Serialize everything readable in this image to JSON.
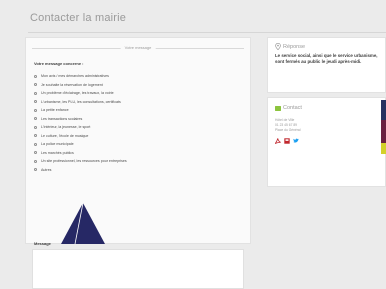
{
  "page": {
    "title": "Contacter la mairie"
  },
  "form": {
    "legend": "Votre message",
    "subject_label": "Votre message concerne :",
    "subjects": [
      "Mon avis / mes démarches administratives",
      "Je souhaite la réservation de logement",
      "Un problème d'éclairage, les travaux, la voirie",
      "L'urbanisme, les PLU, les consultations, certificats",
      "La petite enfance",
      "Les transactions scolaires",
      "L'intérieur, la jeunesse, le sport",
      "Le culture, l'école de musique",
      "La police municipale",
      "Les marchés publics",
      "Un site professionnel, les ressources pour entreprises",
      "Autres"
    ],
    "message_label": "Message"
  },
  "sidebar": {
    "responsable": {
      "title": "Réponse",
      "text": "Le service social, ainsi que le service urbanisme, sont fermés au public le jeudi après-midi."
    },
    "contact": {
      "title": "Contact",
      "lines": [
        "Hôtel de Ville",
        "01 23 45 67 89",
        "Place du Général"
      ]
    },
    "share_icons": [
      "acrobat-icon",
      "print-icon",
      "twitter-icon"
    ]
  },
  "colors": {
    "background": "#ebebeb",
    "panel": "#fafafa",
    "title_gray": "#9a9a9a",
    "text_dark": "#3d3d3d",
    "contact_green": "#8cc43e",
    "share_red": "#c0272d",
    "twitter_blue": "#1da1f2",
    "cursor_navy": "#262865",
    "band": [
      "#263060",
      "#6a1f3f",
      "#d3d12a"
    ]
  }
}
